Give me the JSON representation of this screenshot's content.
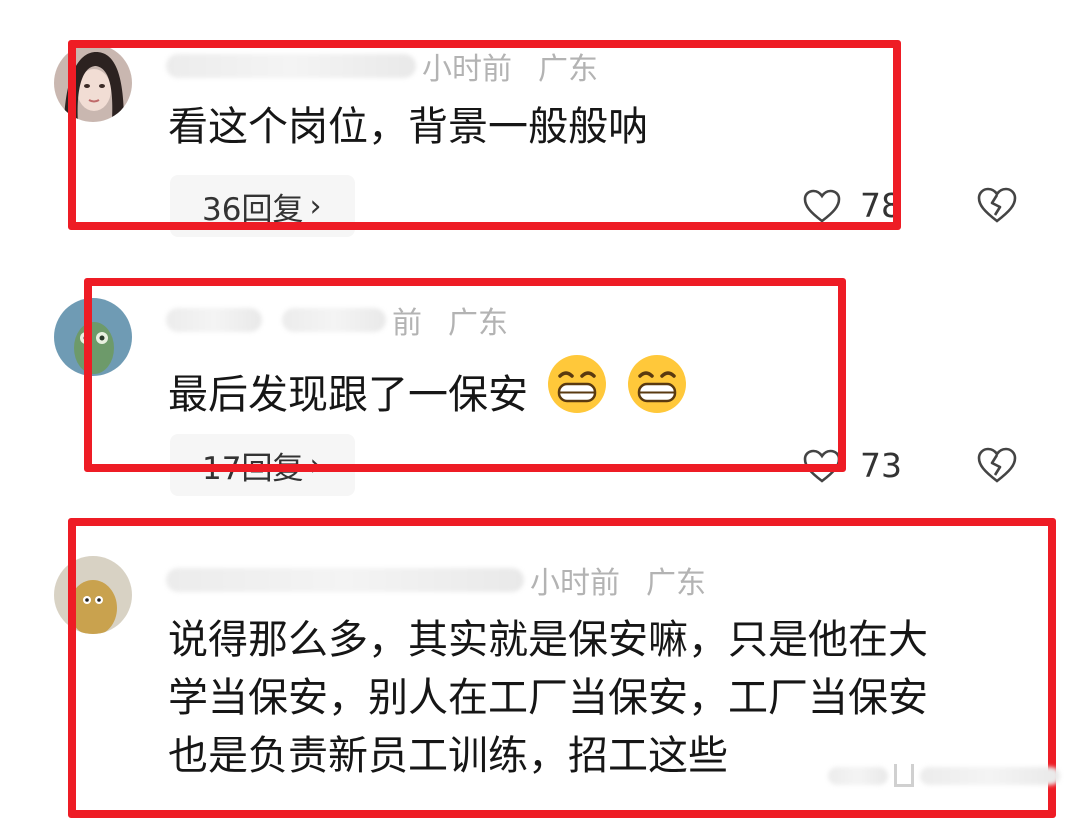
{
  "comments": [
    {
      "time": "小时前",
      "location": "广东",
      "text": [
        "看这个岗位，背景一般般呐"
      ],
      "replies": "36回复",
      "likes": "78"
    },
    {
      "time": "前",
      "location": "广东",
      "text": [
        "最后发现跟了一保安"
      ],
      "replies": "17回复",
      "likes": "73"
    },
    {
      "time": "小时前",
      "location": "广东",
      "text": [
        "说得那么多，其实就是保安嘛，只是他在大",
        "学当保安，别人在工厂当保安，工厂当保安",
        "也是负责新员工训练，招工这些"
      ]
    }
  ],
  "icons": {
    "like": "heart-outline-icon",
    "dislike": "broken-heart-icon",
    "emoji": "grinning-emoji-icon"
  },
  "colors": {
    "highlight_box": "#ee1c25",
    "meta_text": "#b3b3b3"
  }
}
